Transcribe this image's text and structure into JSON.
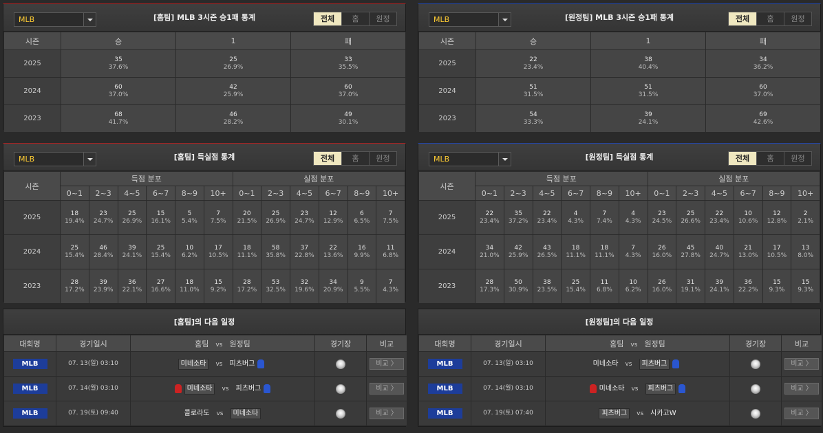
{
  "league": "MLB",
  "filter_tabs": [
    "전체",
    "홈",
    "원정"
  ],
  "wdl": {
    "headers": [
      "시즌",
      "승",
      "1",
      "패"
    ],
    "home": {
      "title": "[홈팀] MLB 3시즌 승1패 통계",
      "rows": [
        {
          "season": "2025",
          "cells": [
            [
              "35",
              "37.6%"
            ],
            [
              "25",
              "26.9%"
            ],
            [
              "33",
              "35.5%"
            ]
          ]
        },
        {
          "season": "2024",
          "cells": [
            [
              "60",
              "37.0%"
            ],
            [
              "42",
              "25.9%"
            ],
            [
              "60",
              "37.0%"
            ]
          ]
        },
        {
          "season": "2023",
          "cells": [
            [
              "68",
              "41.7%"
            ],
            [
              "46",
              "28.2%"
            ],
            [
              "49",
              "30.1%"
            ]
          ]
        }
      ]
    },
    "away": {
      "title": "[원정팀] MLB 3시즌 승1패 통계",
      "rows": [
        {
          "season": "2025",
          "cells": [
            [
              "22",
              "23.4%"
            ],
            [
              "38",
              "40.4%"
            ],
            [
              "34",
              "36.2%"
            ]
          ]
        },
        {
          "season": "2024",
          "cells": [
            [
              "51",
              "31.5%"
            ],
            [
              "51",
              "31.5%"
            ],
            [
              "60",
              "37.0%"
            ]
          ]
        },
        {
          "season": "2023",
          "cells": [
            [
              "54",
              "33.3%"
            ],
            [
              "39",
              "24.1%"
            ],
            [
              "69",
              "42.6%"
            ]
          ]
        }
      ]
    }
  },
  "score": {
    "season_label": "시즌",
    "scored_label": "득점 분포",
    "conceded_label": "실점 분포",
    "ranges": [
      "0~1",
      "2~3",
      "4~5",
      "6~7",
      "8~9",
      "10+"
    ],
    "home": {
      "title": "[홈팀] 득실점 통계",
      "rows": [
        {
          "season": "2025",
          "scored": [
            [
              "18",
              "19.4%"
            ],
            [
              "23",
              "24.7%"
            ],
            [
              "25",
              "26.9%"
            ],
            [
              "15",
              "16.1%"
            ],
            [
              "5",
              "5.4%"
            ],
            [
              "7",
              "7.5%"
            ]
          ],
          "conceded": [
            [
              "20",
              "21.5%"
            ],
            [
              "25",
              "26.9%"
            ],
            [
              "23",
              "24.7%"
            ],
            [
              "12",
              "12.9%"
            ],
            [
              "6",
              "6.5%"
            ],
            [
              "7",
              "7.5%"
            ]
          ]
        },
        {
          "season": "2024",
          "scored": [
            [
              "25",
              "15.4%"
            ],
            [
              "46",
              "28.4%"
            ],
            [
              "39",
              "24.1%"
            ],
            [
              "25",
              "15.4%"
            ],
            [
              "10",
              "6.2%"
            ],
            [
              "17",
              "10.5%"
            ]
          ],
          "conceded": [
            [
              "18",
              "11.1%"
            ],
            [
              "58",
              "35.8%"
            ],
            [
              "37",
              "22.8%"
            ],
            [
              "22",
              "13.6%"
            ],
            [
              "16",
              "9.9%"
            ],
            [
              "11",
              "6.8%"
            ]
          ]
        },
        {
          "season": "2023",
          "scored": [
            [
              "28",
              "17.2%"
            ],
            [
              "39",
              "23.9%"
            ],
            [
              "36",
              "22.1%"
            ],
            [
              "27",
              "16.6%"
            ],
            [
              "18",
              "11.0%"
            ],
            [
              "15",
              "9.2%"
            ]
          ],
          "conceded": [
            [
              "28",
              "17.2%"
            ],
            [
              "53",
              "32.5%"
            ],
            [
              "32",
              "19.6%"
            ],
            [
              "34",
              "20.9%"
            ],
            [
              "9",
              "5.5%"
            ],
            [
              "7",
              "4.3%"
            ]
          ]
        }
      ]
    },
    "away": {
      "title": "[원정팀] 득실점 통계",
      "rows": [
        {
          "season": "2025",
          "scored": [
            [
              "22",
              "23.4%"
            ],
            [
              "35",
              "37.2%"
            ],
            [
              "22",
              "23.4%"
            ],
            [
              "4",
              "4.3%"
            ],
            [
              "7",
              "7.4%"
            ],
            [
              "4",
              "4.3%"
            ]
          ],
          "conceded": [
            [
              "23",
              "24.5%"
            ],
            [
              "25",
              "26.6%"
            ],
            [
              "22",
              "23.4%"
            ],
            [
              "10",
              "10.6%"
            ],
            [
              "12",
              "12.8%"
            ],
            [
              "2",
              "2.1%"
            ]
          ]
        },
        {
          "season": "2024",
          "scored": [
            [
              "34",
              "21.0%"
            ],
            [
              "42",
              "25.9%"
            ],
            [
              "43",
              "26.5%"
            ],
            [
              "18",
              "11.1%"
            ],
            [
              "18",
              "11.1%"
            ],
            [
              "7",
              "4.3%"
            ]
          ],
          "conceded": [
            [
              "26",
              "16.0%"
            ],
            [
              "45",
              "27.8%"
            ],
            [
              "40",
              "24.7%"
            ],
            [
              "21",
              "13.0%"
            ],
            [
              "17",
              "10.5%"
            ],
            [
              "13",
              "8.0%"
            ]
          ]
        },
        {
          "season": "2023",
          "scored": [
            [
              "28",
              "17.3%"
            ],
            [
              "50",
              "30.9%"
            ],
            [
              "38",
              "23.5%"
            ],
            [
              "25",
              "15.4%"
            ],
            [
              "11",
              "6.8%"
            ],
            [
              "10",
              "6.2%"
            ]
          ],
          "conceded": [
            [
              "26",
              "16.0%"
            ],
            [
              "31",
              "19.1%"
            ],
            [
              "39",
              "24.1%"
            ],
            [
              "36",
              "22.2%"
            ],
            [
              "15",
              "9.3%"
            ],
            [
              "15",
              "9.3%"
            ]
          ]
        }
      ]
    }
  },
  "schedule": {
    "headers": {
      "league": "대회명",
      "date": "경기일시",
      "home": "홈팀",
      "vs": "vs",
      "away": "원정팀",
      "venue": "경기장",
      "compare": "비교"
    },
    "compare_label": "비교 〉",
    "home": {
      "title": "[홈팀]의 다음 일정",
      "rows": [
        {
          "league": "MLB",
          "date": "07. 13(일) 03:10",
          "home": "미네소타",
          "away": "피츠버그",
          "home_boxed": true,
          "away_boxed": false,
          "home_icon": "",
          "away_icon": "blue"
        },
        {
          "league": "MLB",
          "date": "07. 14(월) 03:10",
          "home": "미네소타",
          "away": "피츠버그",
          "home_boxed": true,
          "away_boxed": false,
          "home_icon": "red",
          "away_icon": "blue"
        },
        {
          "league": "MLB",
          "date": "07. 19(토) 09:40",
          "home": "콜로라도",
          "away": "미네소타",
          "home_boxed": false,
          "away_boxed": true,
          "home_icon": "",
          "away_icon": ""
        }
      ]
    },
    "away": {
      "title": "[원정팀]의 다음 일정",
      "rows": [
        {
          "league": "MLB",
          "date": "07. 13(일) 03:10",
          "home": "미네소타",
          "away": "피츠버그",
          "home_boxed": false,
          "away_boxed": true,
          "home_icon": "",
          "away_icon": "blue"
        },
        {
          "league": "MLB",
          "date": "07. 14(월) 03:10",
          "home": "미네소타",
          "away": "피츠버그",
          "home_boxed": false,
          "away_boxed": true,
          "home_icon": "red",
          "away_icon": "blue"
        },
        {
          "league": "MLB",
          "date": "07. 19(토) 07:40",
          "home": "피츠버그",
          "away": "시카고W",
          "home_boxed": true,
          "away_boxed": false,
          "home_icon": "",
          "away_icon": ""
        }
      ]
    }
  }
}
